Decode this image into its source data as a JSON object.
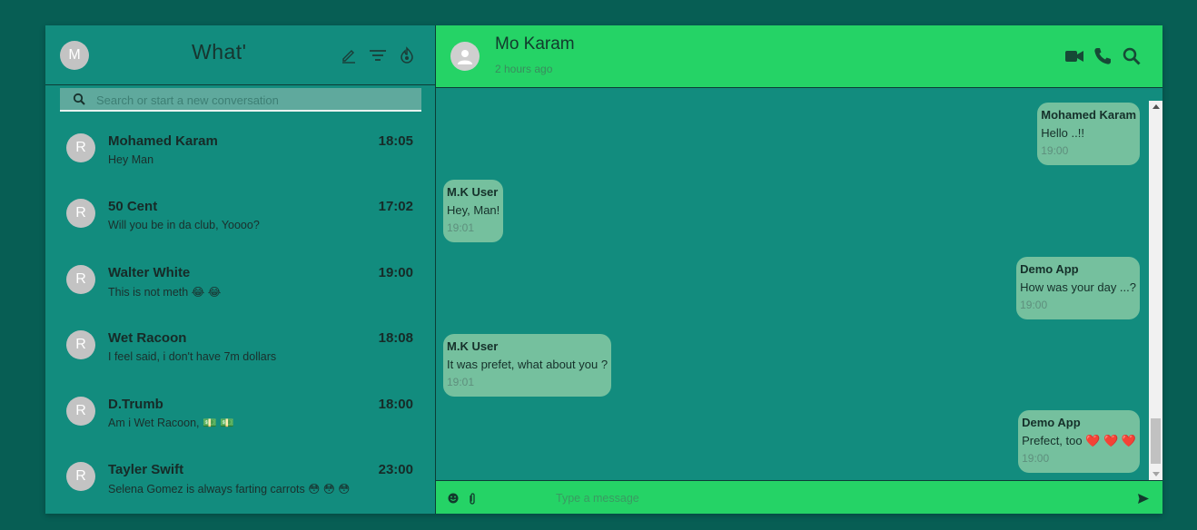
{
  "sidebar": {
    "user_avatar_letter": "M",
    "app_title": "What'",
    "search_placeholder": "Search or start a new conversation",
    "chats": [
      {
        "avatar": "R",
        "name": "Mohamed Karam",
        "time": "18:05",
        "message": "Hey Man"
      },
      {
        "avatar": "R",
        "name": "50 Cent",
        "time": "17:02",
        "message": "Will you be in da club, Yoooo?"
      },
      {
        "avatar": "R",
        "name": "Walter White",
        "time": "19:00",
        "message": "This is not meth 😂 😂"
      },
      {
        "avatar": "R",
        "name": "Wet Racoon",
        "time": "18:08",
        "message": "I feel said, i don't have 7m dollars"
      },
      {
        "avatar": "R",
        "name": "D.Trumb",
        "time": "18:00",
        "message": "Am i Wet Racoon, 💵 💵"
      },
      {
        "avatar": "R",
        "name": "Tayler Swift",
        "time": "23:00",
        "message": "Selena Gomez is always farting carrots 😳 😳 😳"
      }
    ]
  },
  "chat": {
    "contact_name": "Mo Karam",
    "status": "2 hours ago",
    "messages": [
      {
        "sender": "Mohamed Karam",
        "text": "Hello ..!!",
        "time": "19:00",
        "direction": "outgoing"
      },
      {
        "sender": "M.K User",
        "text": "Hey, Man!",
        "time": "19:01",
        "direction": "incoming"
      },
      {
        "sender": "Demo App",
        "text": "How was your day ...?",
        "time": "19:00",
        "direction": "outgoing"
      },
      {
        "sender": "M.K User",
        "text": "It was prefet, what about you ?",
        "time": "19:01",
        "direction": "incoming"
      },
      {
        "sender": "Demo App",
        "text": "Prefect, too ❤️ ❤️ ❤️",
        "time": "19:00",
        "direction": "outgoing"
      }
    ],
    "composer_placeholder": "Type a message"
  },
  "icons": {
    "sidebar_header": [
      "edit-icon",
      "filter-icon",
      "status-icon"
    ],
    "chat_header": [
      "video-call-icon",
      "phone-icon",
      "search-icon"
    ],
    "composer": [
      "emoji-icon",
      "attach-icon",
      "send-icon"
    ]
  },
  "colors": {
    "background": "#075e54",
    "panel": "#128c7e",
    "header_accent": "#25d366",
    "bubble": "#75c09e"
  }
}
